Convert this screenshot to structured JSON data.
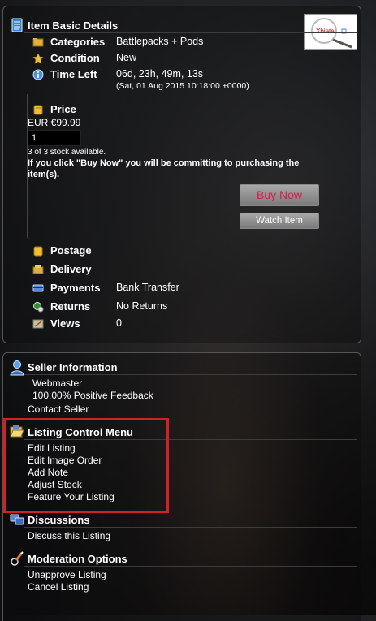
{
  "basic": {
    "title": "Item Basic Details",
    "categories_label": "Categories",
    "categories_value": "Battlepacks + Pods",
    "condition_label": "Condition",
    "condition_value": "New",
    "time_left_label": "Time Left",
    "time_left_value": "06d, 23h, 49m, 13s",
    "time_left_date": "(Sat, 01 Aug 2015 10:18:00 +0000)",
    "thumbnail_text": "Xbiete"
  },
  "price": {
    "title": "Price",
    "amount": "EUR €99.99",
    "quantity": "1",
    "stock": "3 of 3 stock available.",
    "notice": "If you click \"Buy Now\" you will be committing to purchasing the item(s).",
    "buy_label": "Buy Now",
    "watch_label": "Watch Item"
  },
  "details": {
    "postage_label": "Postage",
    "delivery_label": "Delivery",
    "payments_label": "Payments",
    "payments_value": "Bank Transfer",
    "returns_label": "Returns",
    "returns_value": "No Returns",
    "views_label": "Views",
    "views_value": "0"
  },
  "seller": {
    "title": "Seller Information",
    "name": "Webmaster",
    "feedback": "100.00% Positive Feedback",
    "contact": "Contact Seller"
  },
  "listing_menu": {
    "title": "Listing Control Menu",
    "items": [
      "Edit Listing",
      "Edit Image Order",
      "Add Note",
      "Adjust Stock",
      "Feature Your Listing"
    ]
  },
  "discussions": {
    "title": "Discussions",
    "link": "Discuss this Listing"
  },
  "moderation": {
    "title": "Moderation Options",
    "items": [
      "Unapprove Listing",
      "Cancel Listing"
    ]
  },
  "colors": {
    "buy_text": "#d81b4f",
    "highlight": "#d0202a"
  }
}
